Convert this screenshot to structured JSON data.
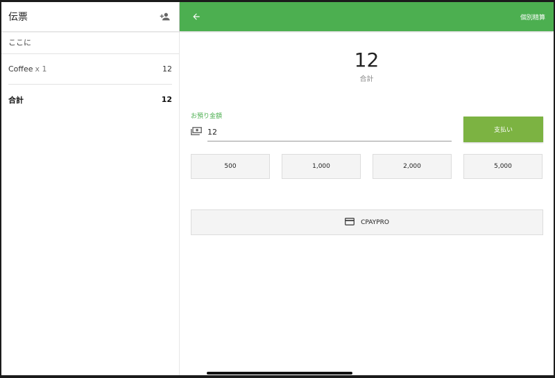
{
  "left_panel": {
    "title": "伝票",
    "customer_placeholder": "ここに",
    "items": [
      {
        "name": "Coffee",
        "qty": "x 1",
        "amount": "12"
      }
    ],
    "total_label": "合計",
    "total_value": "12"
  },
  "app_bar": {
    "split_label": "個別精算"
  },
  "summary": {
    "amount": "12",
    "label": "合計"
  },
  "received": {
    "label": "お預り金額",
    "value": "12"
  },
  "pay_button": "支払い",
  "quick_amounts": [
    "500",
    "1,000",
    "2,000",
    "5,000"
  ],
  "payment_method": "CPAYPRO",
  "colors": {
    "appbar": "#4caf50",
    "pay_button": "#7cb342",
    "accent_label": "#4caf50"
  },
  "icons": {
    "add_person": "person-add-icon",
    "back": "arrow-back-icon",
    "cash": "cash-icon",
    "card": "credit-card-icon"
  }
}
